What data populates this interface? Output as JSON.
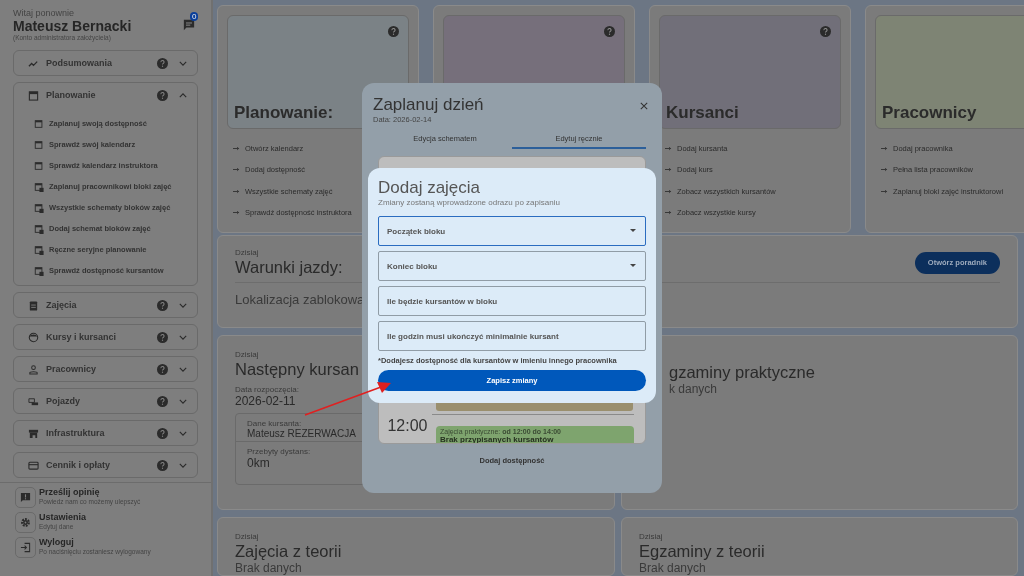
{
  "sidebar": {
    "greeting": "Witaj ponownie",
    "user_name": "Mateusz Bernacki",
    "role": "(Konto administratora założyciela)",
    "notifications": "0",
    "sections": [
      {
        "label": "Podsumowania",
        "expanded": false
      },
      {
        "label": "Planowanie",
        "expanded": true,
        "items": [
          "Zaplanuj swoją dostępność",
          "Sprawdź swój kalendarz",
          "Sprawdź kalendarz instruktora",
          "Zaplanuj pracownikowi bloki zajęć",
          "Wszystkie schematy bloków zajęć",
          "Dodaj schemat bloków zajęć",
          "Ręczne seryjne planowanie",
          "Sprawdź dostępność kursantów"
        ]
      },
      {
        "label": "Zajęcia",
        "expanded": false
      },
      {
        "label": "Kursy i kursanci",
        "expanded": false
      },
      {
        "label": "Pracownicy",
        "expanded": false
      },
      {
        "label": "Pojazdy",
        "expanded": false
      },
      {
        "label": "Infrastruktura",
        "expanded": false
      },
      {
        "label": "Cennik i opłaty",
        "expanded": false
      }
    ],
    "footer": [
      {
        "title": "Prześlij opinię",
        "subtitle": "Powiedz nam co możemy ulepszyć"
      },
      {
        "title": "Ustawienia",
        "subtitle": "Edytuj dane"
      },
      {
        "title": "Wyloguj",
        "subtitle": "Po naciśnięciu zostaniesz wylogowany"
      }
    ]
  },
  "cards": [
    {
      "title": "Planowanie:",
      "help": true,
      "color": "#7b8286",
      "links": [
        "Otwórz kalendarz",
        "Dodaj dostępność",
        "Wszystkie schematy zajęć",
        "Sprawdź dostępność instruktora"
      ]
    },
    {
      "help": true,
      "color": "#766f7b"
    },
    {
      "title": "Kursanci",
      "help": true,
      "color": "#716f79",
      "links": [
        "Dodaj kursanta",
        "Dodaj kurs",
        "Zobacz wszystkich kursantów",
        "Zobacz wszystkie kursy"
      ]
    },
    {
      "title": "Pracownicy",
      "color": "#7e8474",
      "links": [
        "Dodaj pracownika",
        "Pełna lista pracowników",
        "Zaplanuj bloki zajęć instruktorowi"
      ]
    }
  ],
  "driving_conditions": {
    "caption": "Dzisiaj",
    "title": "Warunki jazdy:",
    "text": "Lokalizacja zablokowa",
    "button": "Otwórz poradnik"
  },
  "next_student": {
    "caption": "Dzisiaj",
    "title": "Następny kursan",
    "start_label": "Data rozpoczęcia:",
    "start_date": "2026-02-11",
    "student_label": "Dane kursanta:",
    "student_name": "Mateusz REZERWACJA",
    "distance_label": "Przebyty dystans:",
    "distance": "0km"
  },
  "practical_exams": {
    "title": "gzaminy praktyczne",
    "text": "k danych"
  },
  "theory_classes": {
    "caption": "Dzisiaj",
    "title": "Zajęcia z teorii",
    "text": "Brak danych"
  },
  "theory_exams": {
    "caption": "Dzisiaj",
    "title": "Egzaminy z teorii",
    "text": "Brak danych"
  },
  "schedule_dialog": {
    "title": "Zaplanuj dzień",
    "date": "Data: 2026-02-14",
    "tabs": [
      {
        "label": "Edycja schematem",
        "selected": false
      },
      {
        "label": "Edytuj ręcznie",
        "selected": true
      }
    ],
    "calendar": {
      "time": "12:00",
      "events": [
        {
          "kind": "block",
          "color": "#9a8f6e"
        },
        {
          "kind": "event",
          "color": "#7ea46e",
          "label": "Zajęcia praktyczne: **od 12:00 do 14:00**",
          "status": "Brak przypisanych kursantów"
        }
      ]
    },
    "add_button": "Dodaj dostępność"
  },
  "add_dialog": {
    "title": "Dodaj zajęcia",
    "subtitle": "Zmiany zostaną wprowadzone odrazu po zapisaniu",
    "fields": [
      {
        "kind": "select",
        "placeholder": "Początek bloku",
        "focused": true
      },
      {
        "kind": "select",
        "placeholder": "Koniec bloku",
        "focused": false
      },
      {
        "kind": "input",
        "placeholder": "Ile będzie kursantów w bloku",
        "focused": false
      },
      {
        "kind": "input",
        "placeholder": "Ile godzin musi ukończyć minimalnie kursant",
        "focused": false
      }
    ],
    "note": "*Dodajesz dostępność dla kursantów w imieniu innego pracownika",
    "button": "Zapisz zmiany"
  }
}
